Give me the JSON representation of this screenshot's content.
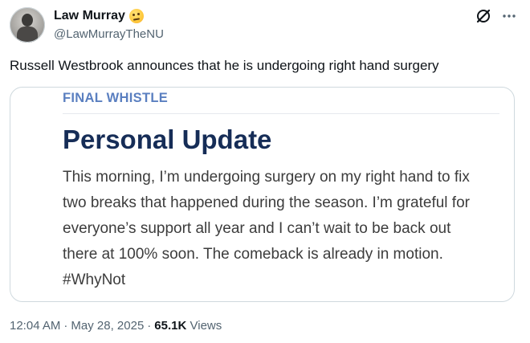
{
  "author": {
    "display_name": "Law Murray",
    "badge_emoji": "thinking-face-emoji",
    "handle": "@LawMurrayTheNU"
  },
  "actions": {
    "grok_icon": "grok-icon",
    "more_icon": "more-icon"
  },
  "tweet": {
    "text": "Russell Westbrook announces that he is undergoing right hand surgery"
  },
  "card": {
    "kicker": "FINAL WHISTLE",
    "title": "Personal Update",
    "body": "This morning, I’m undergoing surgery on my right hand to fix two breaks that happened during the season. I’m grateful for everyone’s support all year and I can’t wait to be back out there at 100% soon. The comeback is already in motion. #WhyNot",
    "colors": {
      "kicker": "#5a7fc0",
      "title": "#162d57"
    }
  },
  "meta": {
    "time": "12:04 AM",
    "separator": "·",
    "date": "May 28, 2025",
    "views_count": "65.1K",
    "views_label": "Views"
  }
}
